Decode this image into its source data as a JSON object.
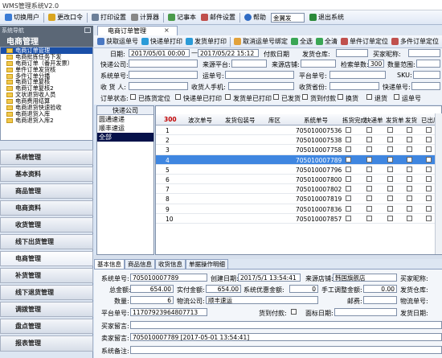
{
  "window": {
    "title": "WMS管理系统V2.0"
  },
  "toolbar": {
    "items": [
      "切换用户",
      "更改口令",
      "打印设置",
      "计算器",
      "记事本",
      "邮件设置",
      "帮助"
    ],
    "warehouse": "金翼发",
    "exit": "退出系统"
  },
  "sidebar": {
    "header_small": "系统导航",
    "header": "电商管理",
    "tree": [
      "电商订单管理",
      "电商批拣任务下发",
      "电商订单（番开发票）",
      "单件订单发货核",
      "多件订单分播",
      "电商订单复核",
      "电商订单复核2",
      "文状退货收人员",
      "电商费用结算",
      "电商退货快速验收",
      "电商退货入库",
      "电商退货入库2"
    ],
    "selected_tree": "电商订单管理",
    "nav": [
      "系统管理",
      "基本资料",
      "商品管理",
      "电商资料",
      "收货管理",
      "线下出货管理",
      "电商管理",
      "补货管理",
      "线下退货管理",
      "调拨管理",
      "盘点管理",
      "报表管理"
    ],
    "active_nav": "电商管理"
  },
  "tab": {
    "title": "电商订单管理",
    "close": "×"
  },
  "actions": [
    "获取运单号",
    "快递单打印",
    "发货单打印",
    "取消运单号绑定",
    "全选",
    "全清",
    "单件订单定位",
    "多件订单定位"
  ],
  "form": {
    "date_label": "日期:",
    "date_from": "2017/05/01 00:00",
    "date_to": "2017/05/22 15:12",
    "pay_date": "付款日期",
    "ship_wh": "发货仓库:",
    "buyer_nick": "买家昵称:",
    "express_co": "快递公司:",
    "source_plat": "来源平台:",
    "source_shop": "来源店铺:",
    "check_count_label": "检索单数:",
    "check_count": "300",
    "qty_range": "数量范围:",
    "system_no": "系统单号:",
    "waybill_no": "运单号:",
    "platform_no": "平台单号:",
    "sku": "SKU:",
    "receiver": "收 货 人:",
    "receiver_phone": "收货人手机:",
    "receiver_prov": "收货省份:",
    "waybill_no2": "快递单号:",
    "status_label": "订单状态:",
    "status": [
      "已拣货定位",
      "快递单已打印",
      "发货单已打印",
      "已发货",
      "货到付款",
      "换货",
      "退货",
      "运单号"
    ]
  },
  "shops": {
    "header": "快递公司",
    "items": [
      "圆通速递",
      "顺丰速运",
      "全部"
    ],
    "selected": "全部"
  },
  "grid": {
    "count": "300",
    "columns": [
      "波次单号",
      "发货包装号",
      "库区",
      "系统单号",
      "拣货完成",
      "快递单",
      "发货单",
      "发货",
      "已出库"
    ],
    "rows": [
      {
        "n": "1",
        "no": "705010007536"
      },
      {
        "n": "2",
        "no": "705010007538"
      },
      {
        "n": "3",
        "no": "705010007758"
      },
      {
        "n": "4",
        "no": "705010007789"
      },
      {
        "n": "5",
        "no": "705010007796"
      },
      {
        "n": "6",
        "no": "705010007800"
      },
      {
        "n": "7",
        "no": "705010007802"
      },
      {
        "n": "8",
        "no": "705010007819"
      },
      {
        "n": "9",
        "no": "705010007836"
      },
      {
        "n": "10",
        "no": "705010007857"
      }
    ],
    "selected_row": "4"
  },
  "detail_tabs": [
    "基本信息",
    "商品信息",
    "收货信息",
    "单据操作明细"
  ],
  "detail": {
    "system_no_label": "系统单号:",
    "system_no": "705010007789",
    "created_label": "创建日期:",
    "created": "2017/5/1 13:54:41",
    "shop_label": "来源店铺:",
    "shop": "韩国旗舰店",
    "buyer_label": "买家昵称:",
    "total_label": "总金额:",
    "total": "654.00",
    "paid_label": "实付金额:",
    "paid": "654.00",
    "discount_label": "系统优惠金额:",
    "discount": "0",
    "manual_label": "手工调整金额:",
    "manual": "0.00",
    "ship_wh_label": "发货仓库:",
    "qty_label": "数量:",
    "qty": "6",
    "logistics_label": "物流公司:",
    "logistics": "顺丰速运",
    "postcode_label": "邮费:",
    "track_label": "物流单号:",
    "platform_label": "平台单号:",
    "platform": "11707923964807713",
    "cod_label": "货到付款:",
    "refund_label": "面标日期:",
    "ship_date_label": "发货日期:",
    "buyer_msg_label": "买家留言:",
    "seller_msg_label": "卖家留言:",
    "seller_msg": "705010007789 [2017-05-01 13:54:41]",
    "sys_remark_label": "系统备注:"
  }
}
